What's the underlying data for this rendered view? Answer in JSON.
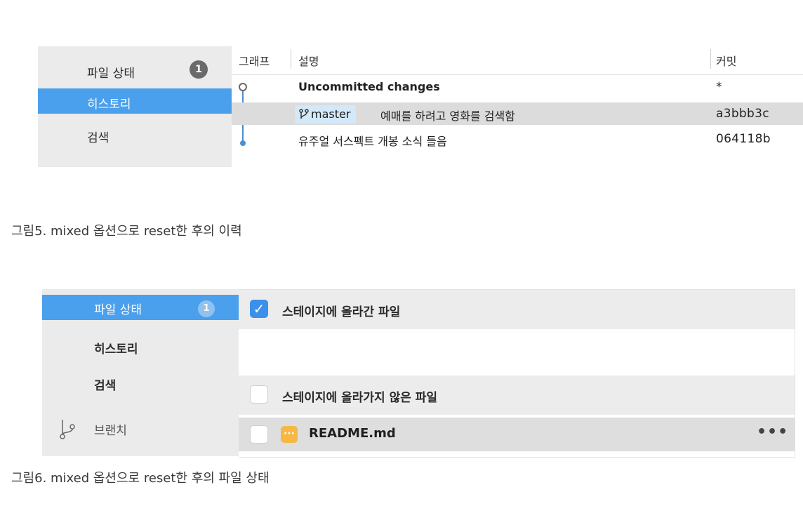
{
  "figure5": {
    "sidebar": {
      "items": [
        {
          "label": "파일 상태",
          "badge": "1"
        },
        {
          "label": "히스토리"
        },
        {
          "label": "검색"
        }
      ]
    },
    "table": {
      "headers": {
        "graph": "그래프",
        "description": "설명",
        "commit": "커밋"
      },
      "rows": [
        {
          "description": "Uncommitted changes",
          "commit": "*"
        },
        {
          "branch": "master",
          "description": "예매를 하려고 영화를 검색함",
          "commit": "a3bbb3c"
        },
        {
          "description": "유주얼 서스펙트 개봉 소식 들음",
          "commit": "064118b"
        }
      ]
    },
    "caption": "그림5. mixed 옵션으로 reset한 후의 이력"
  },
  "figure6": {
    "sidebar": {
      "items": [
        {
          "label": "파일 상태",
          "badge": "1"
        },
        {
          "label": "히스토리"
        },
        {
          "label": "검색"
        },
        {
          "label": "브랜치",
          "icon": "branch-icon"
        }
      ]
    },
    "staged": {
      "label": "스테이지에 올라간 파일",
      "checked": true
    },
    "unstaged": {
      "label": "스테이지에 올라가지 않은 파일",
      "checked": false
    },
    "files": [
      {
        "name": "README.md",
        "icon": "modified-file-icon",
        "more": "•••"
      }
    ],
    "caption": "그림6. mixed 옵션으로 reset한 후의 파일 상태"
  },
  "colors": {
    "selection": "#4aa0ec",
    "checkbox": "#3a90ea",
    "graph_line": "#4a8fd0",
    "file_icon": "#f6b842",
    "branch_tag": "#d3e8f8"
  }
}
